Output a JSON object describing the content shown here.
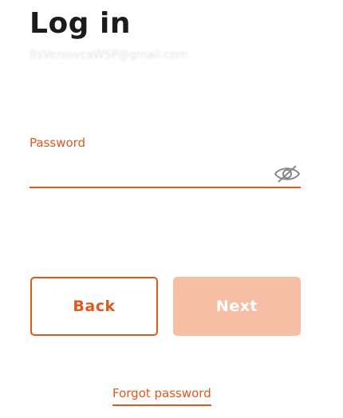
{
  "header": {
    "title": "Log in"
  },
  "account": {
    "email": "ItsVeniovcaWSP@gmail.com"
  },
  "password": {
    "label": "Password",
    "value": "",
    "visibility_icon": "eye-slash-icon"
  },
  "actions": {
    "back_label": "Back",
    "next_label": "Next",
    "next_enabled": false
  },
  "links": {
    "forgot_password": "Forgot password"
  },
  "colors": {
    "accent": "#e2571c",
    "accent_disabled": "#f6bfa5",
    "title": "#1c1c1c"
  }
}
